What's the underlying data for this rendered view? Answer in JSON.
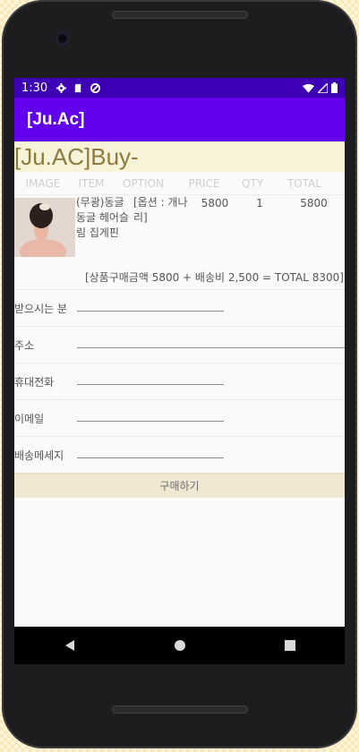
{
  "status": {
    "time": "1:30",
    "icons_left": [
      "gear-icon",
      "sd-card-icon",
      "no-disturb-icon"
    ],
    "icons_right": [
      "wifi-icon",
      "signal-icon",
      "battery-icon"
    ]
  },
  "app_bar": {
    "title": "[Ju.Ac]"
  },
  "page": {
    "title": "[Ju.AC]Buy-"
  },
  "table": {
    "headers": [
      "IMAGE",
      "ITEM",
      "OPTION",
      "PRICE",
      "QTY",
      "TOTAL"
    ],
    "rows": [
      {
        "item": "(무광)동글동글 헤어슬림 집게핀",
        "option": "[옵션 : 개나리]",
        "price": "5800",
        "qty": "1",
        "total": "5800"
      }
    ]
  },
  "summary": "[상품구매금액 5800 + 배송비 2,500 = TOTAL 8300]",
  "form": {
    "recipient_label": "받으시는 분",
    "address_label": "주소",
    "phone_label": "휴대전화",
    "email_label": "이메일",
    "message_label": "배송메세지",
    "recipient_value": "",
    "address_value": "",
    "phone_value": "",
    "email_value": "",
    "message_value": ""
  },
  "buy_button": "구매하기",
  "colors": {
    "status_bar": "#3d00b4",
    "app_bar": "#6200ee",
    "title_bg": "#f7f3d9",
    "title_text": "#8d7a3f",
    "button_bg": "#efe7d1"
  }
}
